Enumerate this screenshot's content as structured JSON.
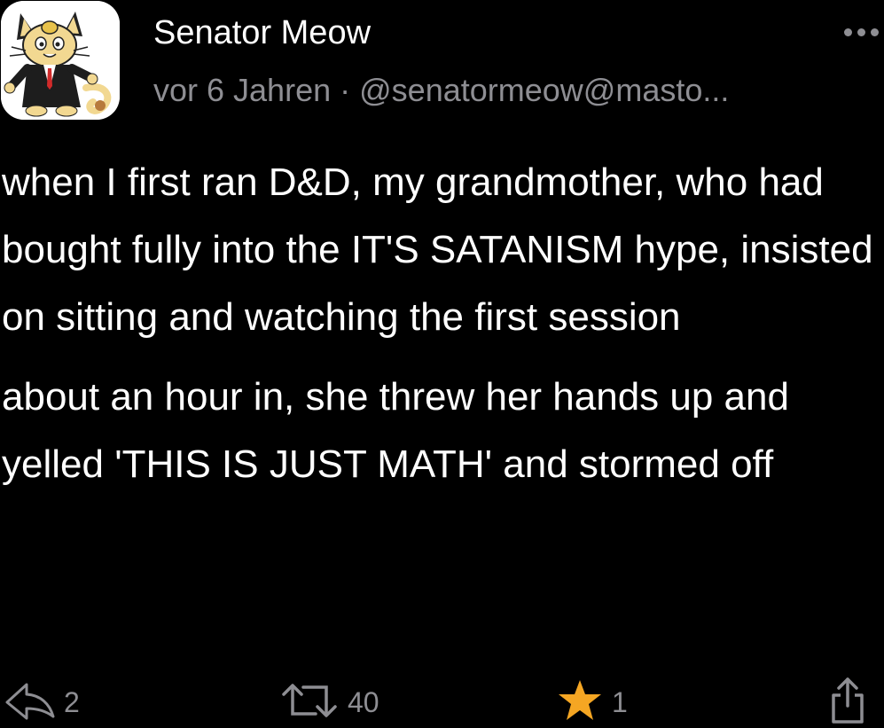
{
  "post": {
    "display_name": "Senator Meow",
    "timestamp": "vor 6 Jahren",
    "separator": "·",
    "handle": "@senatormeow@masto...",
    "paragraphs": [
      "when I first ran D&D, my grandmother, who had bought fully into the IT'S SATANISM hype, insisted on sitting and watching the first session",
      "about an hour in, she threw her hands up and yelled 'THIS IS JUST MATH' and stormed off"
    ]
  },
  "actions": {
    "reply_count": "2",
    "boost_count": "40",
    "favourite_count": "1",
    "reply_icon": "reply-icon",
    "boost_icon": "boost-icon",
    "favourite_icon": "star-icon",
    "share_icon": "share-icon"
  },
  "colors": {
    "background": "#000000",
    "text": "#ffffff",
    "muted": "#8e8e93",
    "star": "#f5a623"
  }
}
